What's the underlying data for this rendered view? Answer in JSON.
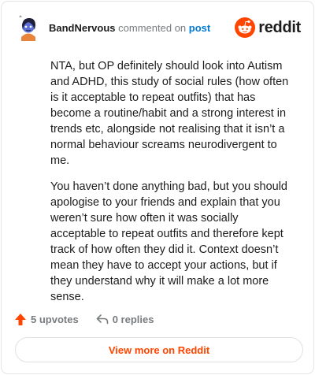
{
  "comment": {
    "author": "BandNervous",
    "action_text": "commented on",
    "post_link": "post",
    "paragraphs": [
      "NTA, but OP definitely should look into Autism and ADHD, this study of social rules (how often is it acceptable to repeat outfits) that has become a routine/habit and a strong interest in trends etc, alongside not realising that it isn’t a normal behaviour screams neurodivergent to me.",
      "You haven’t done anything bad, but you should apologise to your friends and explain that you weren’t sure how often it was socially acceptable to repeat outfits and therefore kept track of how often they did it. Context doesn’t mean they have to accept your actions, but if they understand why it will make a lot more sense."
    ]
  },
  "brand": {
    "name": "reddit",
    "icon": "reddit-snoo-icon",
    "color": "#ff4500"
  },
  "stats": {
    "upvotes": "5 upvotes",
    "replies": "0 replies"
  },
  "actions": {
    "view_more": "View more on Reddit"
  },
  "colors": {
    "accent": "#ff4500",
    "link": "#0079d3",
    "muted": "#787c7e"
  }
}
